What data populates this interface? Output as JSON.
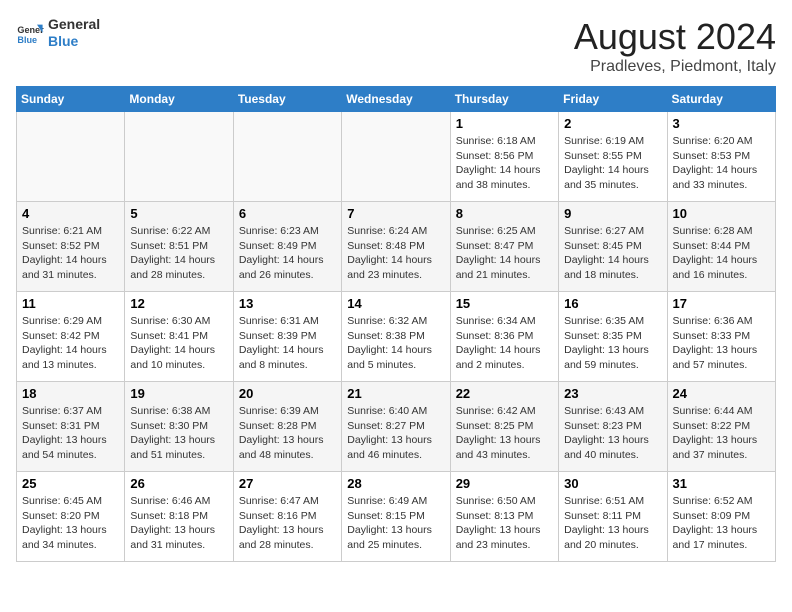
{
  "header": {
    "logo_line1": "General",
    "logo_line2": "Blue",
    "month": "August 2024",
    "location": "Pradleves, Piedmont, Italy"
  },
  "weekdays": [
    "Sunday",
    "Monday",
    "Tuesday",
    "Wednesday",
    "Thursday",
    "Friday",
    "Saturday"
  ],
  "weeks": [
    [
      {
        "day": "",
        "info": ""
      },
      {
        "day": "",
        "info": ""
      },
      {
        "day": "",
        "info": ""
      },
      {
        "day": "",
        "info": ""
      },
      {
        "day": "1",
        "info": "Sunrise: 6:18 AM\nSunset: 8:56 PM\nDaylight: 14 hours\nand 38 minutes."
      },
      {
        "day": "2",
        "info": "Sunrise: 6:19 AM\nSunset: 8:55 PM\nDaylight: 14 hours\nand 35 minutes."
      },
      {
        "day": "3",
        "info": "Sunrise: 6:20 AM\nSunset: 8:53 PM\nDaylight: 14 hours\nand 33 minutes."
      }
    ],
    [
      {
        "day": "4",
        "info": "Sunrise: 6:21 AM\nSunset: 8:52 PM\nDaylight: 14 hours\nand 31 minutes."
      },
      {
        "day": "5",
        "info": "Sunrise: 6:22 AM\nSunset: 8:51 PM\nDaylight: 14 hours\nand 28 minutes."
      },
      {
        "day": "6",
        "info": "Sunrise: 6:23 AM\nSunset: 8:49 PM\nDaylight: 14 hours\nand 26 minutes."
      },
      {
        "day": "7",
        "info": "Sunrise: 6:24 AM\nSunset: 8:48 PM\nDaylight: 14 hours\nand 23 minutes."
      },
      {
        "day": "8",
        "info": "Sunrise: 6:25 AM\nSunset: 8:47 PM\nDaylight: 14 hours\nand 21 minutes."
      },
      {
        "day": "9",
        "info": "Sunrise: 6:27 AM\nSunset: 8:45 PM\nDaylight: 14 hours\nand 18 minutes."
      },
      {
        "day": "10",
        "info": "Sunrise: 6:28 AM\nSunset: 8:44 PM\nDaylight: 14 hours\nand 16 minutes."
      }
    ],
    [
      {
        "day": "11",
        "info": "Sunrise: 6:29 AM\nSunset: 8:42 PM\nDaylight: 14 hours\nand 13 minutes."
      },
      {
        "day": "12",
        "info": "Sunrise: 6:30 AM\nSunset: 8:41 PM\nDaylight: 14 hours\nand 10 minutes."
      },
      {
        "day": "13",
        "info": "Sunrise: 6:31 AM\nSunset: 8:39 PM\nDaylight: 14 hours\nand 8 minutes."
      },
      {
        "day": "14",
        "info": "Sunrise: 6:32 AM\nSunset: 8:38 PM\nDaylight: 14 hours\nand 5 minutes."
      },
      {
        "day": "15",
        "info": "Sunrise: 6:34 AM\nSunset: 8:36 PM\nDaylight: 14 hours\nand 2 minutes."
      },
      {
        "day": "16",
        "info": "Sunrise: 6:35 AM\nSunset: 8:35 PM\nDaylight: 13 hours\nand 59 minutes."
      },
      {
        "day": "17",
        "info": "Sunrise: 6:36 AM\nSunset: 8:33 PM\nDaylight: 13 hours\nand 57 minutes."
      }
    ],
    [
      {
        "day": "18",
        "info": "Sunrise: 6:37 AM\nSunset: 8:31 PM\nDaylight: 13 hours\nand 54 minutes."
      },
      {
        "day": "19",
        "info": "Sunrise: 6:38 AM\nSunset: 8:30 PM\nDaylight: 13 hours\nand 51 minutes."
      },
      {
        "day": "20",
        "info": "Sunrise: 6:39 AM\nSunset: 8:28 PM\nDaylight: 13 hours\nand 48 minutes."
      },
      {
        "day": "21",
        "info": "Sunrise: 6:40 AM\nSunset: 8:27 PM\nDaylight: 13 hours\nand 46 minutes."
      },
      {
        "day": "22",
        "info": "Sunrise: 6:42 AM\nSunset: 8:25 PM\nDaylight: 13 hours\nand 43 minutes."
      },
      {
        "day": "23",
        "info": "Sunrise: 6:43 AM\nSunset: 8:23 PM\nDaylight: 13 hours\nand 40 minutes."
      },
      {
        "day": "24",
        "info": "Sunrise: 6:44 AM\nSunset: 8:22 PM\nDaylight: 13 hours\nand 37 minutes."
      }
    ],
    [
      {
        "day": "25",
        "info": "Sunrise: 6:45 AM\nSunset: 8:20 PM\nDaylight: 13 hours\nand 34 minutes."
      },
      {
        "day": "26",
        "info": "Sunrise: 6:46 AM\nSunset: 8:18 PM\nDaylight: 13 hours\nand 31 minutes."
      },
      {
        "day": "27",
        "info": "Sunrise: 6:47 AM\nSunset: 8:16 PM\nDaylight: 13 hours\nand 28 minutes."
      },
      {
        "day": "28",
        "info": "Sunrise: 6:49 AM\nSunset: 8:15 PM\nDaylight: 13 hours\nand 25 minutes."
      },
      {
        "day": "29",
        "info": "Sunrise: 6:50 AM\nSunset: 8:13 PM\nDaylight: 13 hours\nand 23 minutes."
      },
      {
        "day": "30",
        "info": "Sunrise: 6:51 AM\nSunset: 8:11 PM\nDaylight: 13 hours\nand 20 minutes."
      },
      {
        "day": "31",
        "info": "Sunrise: 6:52 AM\nSunset: 8:09 PM\nDaylight: 13 hours\nand 17 minutes."
      }
    ]
  ]
}
